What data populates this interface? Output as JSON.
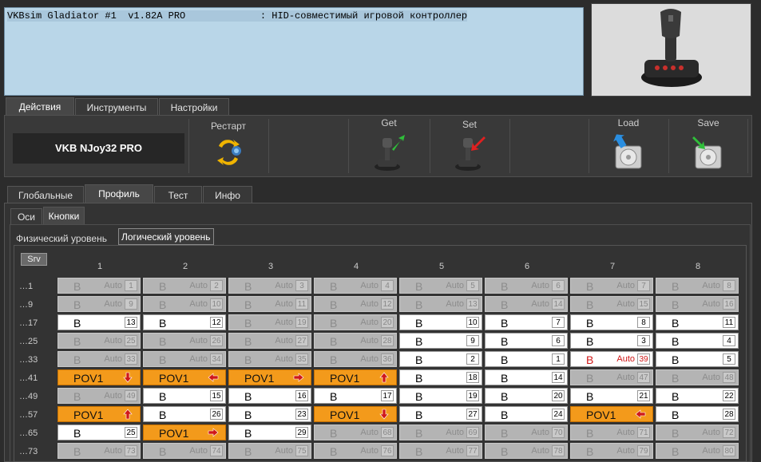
{
  "device": {
    "info_line": "VKBsim Gladiator #1  v1.82A PRO             : HID-совместимый игровой контроллер",
    "image_icon": "joystick-image"
  },
  "main_tabs": [
    "Действия",
    "Инструменты",
    "Настройки"
  ],
  "toolbar": {
    "device_name": "VKB NJoy32 PRO",
    "restart": "Рестарт",
    "get": "Get",
    "set": "Set",
    "load": "Load",
    "save": "Save"
  },
  "profile_tabs": [
    "Глобальные",
    "Профиль",
    "Тест",
    "Инфо"
  ],
  "sub_tabs": [
    "Оси",
    "Кнопки"
  ],
  "level_tabs": [
    "Физический уровень",
    "Логический уровень"
  ],
  "srv_label": "Srv",
  "grid": {
    "columns": [
      "1",
      "2",
      "3",
      "4",
      "5",
      "6",
      "7",
      "8"
    ],
    "rows": [
      {
        "label": "…1",
        "cells": [
          {
            "t": "d",
            "v": "B",
            "a": "Auto",
            "n": "1"
          },
          {
            "t": "d",
            "v": "B",
            "a": "Auto",
            "n": "2"
          },
          {
            "t": "d",
            "v": "B",
            "a": "Auto",
            "n": "3"
          },
          {
            "t": "d",
            "v": "B",
            "a": "Auto",
            "n": "4"
          },
          {
            "t": "d",
            "v": "B",
            "a": "Auto",
            "n": "5"
          },
          {
            "t": "d",
            "v": "B",
            "a": "Auto",
            "n": "6"
          },
          {
            "t": "d",
            "v": "B",
            "a": "Auto",
            "n": "7"
          },
          {
            "t": "d",
            "v": "B",
            "a": "Auto",
            "n": "8"
          }
        ]
      },
      {
        "label": "…9",
        "cells": [
          {
            "t": "d",
            "v": "B",
            "a": "Auto",
            "n": "9"
          },
          {
            "t": "d",
            "v": "B",
            "a": "Auto",
            "n": "10"
          },
          {
            "t": "d",
            "v": "B",
            "a": "Auto",
            "n": "11"
          },
          {
            "t": "d",
            "v": "B",
            "a": "Auto",
            "n": "12"
          },
          {
            "t": "d",
            "v": "B",
            "a": "Auto",
            "n": "13"
          },
          {
            "t": "d",
            "v": "B",
            "a": "Auto",
            "n": "14"
          },
          {
            "t": "d",
            "v": "B",
            "a": "Auto",
            "n": "15"
          },
          {
            "t": "d",
            "v": "B",
            "a": "Auto",
            "n": "16"
          }
        ]
      },
      {
        "label": "…17",
        "cells": [
          {
            "t": "e",
            "v": "B",
            "n": "13"
          },
          {
            "t": "e",
            "v": "B",
            "n": "12"
          },
          {
            "t": "d",
            "v": "B",
            "a": "Auto",
            "n": "19"
          },
          {
            "t": "d",
            "v": "B",
            "a": "Auto",
            "n": "20"
          },
          {
            "t": "e",
            "v": "B",
            "n": "10"
          },
          {
            "t": "e",
            "v": "B",
            "n": "7"
          },
          {
            "t": "e",
            "v": "B",
            "n": "8"
          },
          {
            "t": "e",
            "v": "B",
            "n": "11"
          }
        ]
      },
      {
        "label": "…25",
        "cells": [
          {
            "t": "d",
            "v": "B",
            "a": "Auto",
            "n": "25"
          },
          {
            "t": "d",
            "v": "B",
            "a": "Auto",
            "n": "26"
          },
          {
            "t": "d",
            "v": "B",
            "a": "Auto",
            "n": "27"
          },
          {
            "t": "d",
            "v": "B",
            "a": "Auto",
            "n": "28"
          },
          {
            "t": "e",
            "v": "B",
            "n": "9"
          },
          {
            "t": "e",
            "v": "B",
            "n": "6"
          },
          {
            "t": "e",
            "v": "B",
            "n": "3"
          },
          {
            "t": "e",
            "v": "B",
            "n": "4"
          }
        ]
      },
      {
        "label": "…33",
        "cells": [
          {
            "t": "d",
            "v": "B",
            "a": "Auto",
            "n": "33"
          },
          {
            "t": "d",
            "v": "B",
            "a": "Auto",
            "n": "34"
          },
          {
            "t": "d",
            "v": "B",
            "a": "Auto",
            "n": "35"
          },
          {
            "t": "d",
            "v": "B",
            "a": "Auto",
            "n": "36"
          },
          {
            "t": "e",
            "v": "B",
            "n": "2"
          },
          {
            "t": "e",
            "v": "B",
            "n": "1"
          },
          {
            "t": "e",
            "v": "B",
            "a": "Auto",
            "n": "39",
            "red": true
          },
          {
            "t": "e",
            "v": "B",
            "n": "5"
          }
        ]
      },
      {
        "label": "…41",
        "cells": [
          {
            "t": "p",
            "v": "POV1",
            "dir": "down"
          },
          {
            "t": "p",
            "v": "POV1",
            "dir": "left"
          },
          {
            "t": "p",
            "v": "POV1",
            "dir": "right"
          },
          {
            "t": "p",
            "v": "POV1",
            "dir": "up"
          },
          {
            "t": "e",
            "v": "B",
            "n": "18"
          },
          {
            "t": "e",
            "v": "B",
            "n": "14"
          },
          {
            "t": "d",
            "v": "B",
            "a": "Auto",
            "n": "47"
          },
          {
            "t": "d",
            "v": "B",
            "a": "Auto",
            "n": "48"
          }
        ]
      },
      {
        "label": "…49",
        "cells": [
          {
            "t": "d",
            "v": "B",
            "a": "Auto",
            "n": "49"
          },
          {
            "t": "e",
            "v": "B",
            "n": "15"
          },
          {
            "t": "e",
            "v": "B",
            "n": "16"
          },
          {
            "t": "e",
            "v": "B",
            "n": "17"
          },
          {
            "t": "e",
            "v": "B",
            "n": "19"
          },
          {
            "t": "e",
            "v": "B",
            "n": "20"
          },
          {
            "t": "e",
            "v": "B",
            "n": "21"
          },
          {
            "t": "e",
            "v": "B",
            "n": "22"
          }
        ]
      },
      {
        "label": "…57",
        "cells": [
          {
            "t": "p",
            "v": "POV1",
            "dir": "up"
          },
          {
            "t": "e",
            "v": "B",
            "n": "26"
          },
          {
            "t": "e",
            "v": "B",
            "n": "23"
          },
          {
            "t": "p",
            "v": "POV1",
            "dir": "down"
          },
          {
            "t": "e",
            "v": "B",
            "n": "27"
          },
          {
            "t": "e",
            "v": "B",
            "n": "24"
          },
          {
            "t": "p",
            "v": "POV1",
            "dir": "left"
          },
          {
            "t": "e",
            "v": "B",
            "n": "28"
          }
        ]
      },
      {
        "label": "…65",
        "cells": [
          {
            "t": "e",
            "v": "B",
            "n": "25"
          },
          {
            "t": "p",
            "v": "POV1",
            "dir": "right"
          },
          {
            "t": "e",
            "v": "B",
            "n": "29"
          },
          {
            "t": "d",
            "v": "B",
            "a": "Auto",
            "n": "68"
          },
          {
            "t": "d",
            "v": "B",
            "a": "Auto",
            "n": "69"
          },
          {
            "t": "d",
            "v": "B",
            "a": "Auto",
            "n": "70"
          },
          {
            "t": "d",
            "v": "B",
            "a": "Auto",
            "n": "71"
          },
          {
            "t": "d",
            "v": "B",
            "a": "Auto",
            "n": "72"
          }
        ]
      },
      {
        "label": "…73",
        "cells": [
          {
            "t": "d",
            "v": "B",
            "a": "Auto",
            "n": "73"
          },
          {
            "t": "d",
            "v": "B",
            "a": "Auto",
            "n": "74"
          },
          {
            "t": "d",
            "v": "B",
            "a": "Auto",
            "n": "75"
          },
          {
            "t": "d",
            "v": "B",
            "a": "Auto",
            "n": "76"
          },
          {
            "t": "d",
            "v": "B",
            "a": "Auto",
            "n": "77"
          },
          {
            "t": "d",
            "v": "B",
            "a": "Auto",
            "n": "78"
          },
          {
            "t": "d",
            "v": "B",
            "a": "Auto",
            "n": "79"
          },
          {
            "t": "d",
            "v": "B",
            "a": "Auto",
            "n": "80"
          }
        ]
      }
    ]
  },
  "colors": {
    "pov_orange": "#f39a1b",
    "arrow_red": "#d01818",
    "disabled_cell": "#b4b4b4",
    "enabled_cell": "#ffffff",
    "device_panel": "#b9d6e8"
  }
}
